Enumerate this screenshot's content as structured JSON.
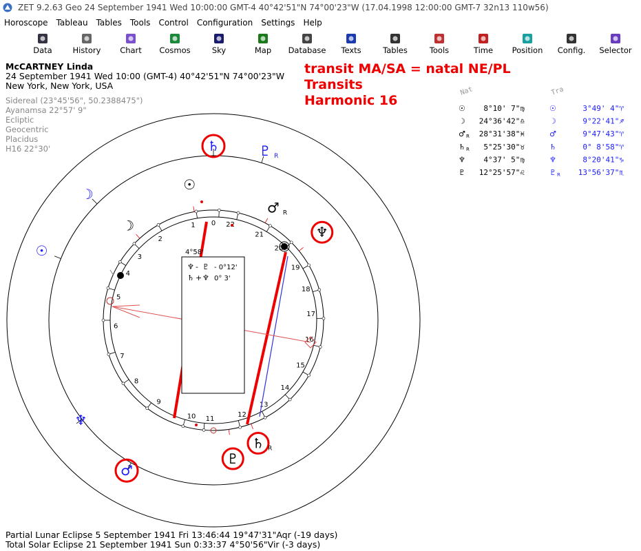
{
  "window": {
    "title": "ZET 9.2.63 Geo   24 September 1941  Wed  10:00:00 GMT-4 40°42'51\"N  74°00'23\"W  (17.04.1998  12:00:00 GMT-7 32n13 110w56)"
  },
  "menu": [
    "Horoscope",
    "Tableau",
    "Tables",
    "Tools",
    "Control",
    "Configuration",
    "Settings",
    "Help"
  ],
  "toolbar": [
    {
      "label": "Data",
      "icon": "data-icon"
    },
    {
      "label": "History",
      "icon": "history-icon"
    },
    {
      "label": "Chart",
      "icon": "chart-icon"
    },
    {
      "label": "Cosmos",
      "icon": "cosmos-icon"
    },
    {
      "label": "Sky",
      "icon": "sky-icon"
    },
    {
      "label": "Map",
      "icon": "map-icon"
    },
    {
      "label": "Database",
      "icon": "database-icon"
    },
    {
      "label": "Texts",
      "icon": "texts-icon"
    },
    {
      "label": "Tables",
      "icon": "tables-icon"
    },
    {
      "label": "Tools",
      "icon": "tools-icon"
    },
    {
      "label": "Time",
      "icon": "time-icon"
    },
    {
      "label": "Position",
      "icon": "position-icon"
    },
    {
      "label": "Config.",
      "icon": "config-icon"
    },
    {
      "label": "Selector",
      "icon": "selector-icon"
    }
  ],
  "header": {
    "name": "McCARTNEY Linda",
    "date_line": "24 September 1941  Wed  10:00 (GMT-4) 40°42'51\"N  74°00'23\"W",
    "place": "New York, New York, USA"
  },
  "subinfo": [
    "Sidereal (23°45'56\", 50.2388475\")",
    "Ayanamsa 22°57' 9\"",
    "Ecliptic",
    "Geocentric",
    "Placidus",
    "H16  22°30'"
  ],
  "annotation": [
    "transit MA/SA = natal NE/PL",
    "Transits",
    "Harmonic 16"
  ],
  "table": {
    "col1_header": "Nat",
    "col2_header": "Tra",
    "rows": [
      {
        "p1": "☉",
        "r1": "",
        "v1": "8°10' 7\"♍",
        "p2": "☉",
        "r2": "",
        "v2": "3°49' 4\"♈"
      },
      {
        "p1": "☽",
        "r1": "",
        "v1": "24°36'42\"♎",
        "p2": "☽",
        "r2": "",
        "v2": "9°22'41\"♐"
      },
      {
        "p1": "♂",
        "r1": "R",
        "v1": "28°31'38\"♓",
        "p2": "♂",
        "r2": "",
        "v2": "9°47'43\"♈"
      },
      {
        "p1": "♄",
        "r1": "R",
        "v1": "5°25'30\"♉",
        "p2": "♄",
        "r2": "",
        "v2": "0° 8'58\"♈"
      },
      {
        "p1": "♆",
        "r1": "",
        "v1": "4°37' 5\"♍",
        "p2": "♆",
        "r2": "",
        "v2": "8°20'41\"♑"
      },
      {
        "p1": "♇",
        "r1": "",
        "v1": "12°25'57\"♌",
        "p2": "♇",
        "r2": "R",
        "v2": "13°56'37\"♏"
      }
    ]
  },
  "chart": {
    "house_numbers": [
      "0",
      "1",
      "2",
      "3",
      "4",
      "5",
      "6",
      "7",
      "8",
      "9",
      "10",
      "11",
      "12",
      "13",
      "14",
      "15",
      "16",
      "17",
      "18",
      "19",
      "20",
      "21",
      "22"
    ],
    "inner_planets": [
      {
        "glyph": "☽",
        "r": "",
        "color": "#000",
        "circled": false
      },
      {
        "glyph": "☉",
        "r": "",
        "color": "#000",
        "circled": false
      },
      {
        "glyph": "♂",
        "r": "R",
        "color": "#000",
        "circled": false
      },
      {
        "glyph": "♆",
        "r": "",
        "color": "#000",
        "circled": true
      },
      {
        "glyph": "♇",
        "r": "",
        "color": "#000",
        "circled": true
      },
      {
        "glyph": "♄",
        "r": "R",
        "color": "#000",
        "circled": true
      }
    ],
    "outer_planets": [
      {
        "glyph": "♄",
        "r": "",
        "color": "#1a1aff",
        "circled": true
      },
      {
        "glyph": "♇",
        "r": "R",
        "color": "#1a1aff",
        "circled": false
      },
      {
        "glyph": "☽",
        "r": "",
        "color": "#1a1aff",
        "circled": false
      },
      {
        "glyph": "☉",
        "r": "",
        "color": "#1a1aff",
        "circled": false
      },
      {
        "glyph": "♆",
        "r": "",
        "color": "#1a1aff",
        "circled": false
      },
      {
        "glyph": "♂",
        "r": "",
        "color": "#1a1aff",
        "circled": true
      }
    ],
    "midpoint_label": "4°58'",
    "aspect_box": [
      {
        "a": "♆",
        "sep": "-",
        "b": "♇",
        "val": "- 0°12'"
      },
      {
        "a": "♄",
        "sep": "+",
        "b": "♆",
        "val": "0° 3'"
      }
    ]
  },
  "footer": [
    "Partial Lunar Eclipse 5 September 1941 Fri 13:46:44 19°47'31\"Aqr (-19 days)",
    "Total Solar Eclipse 21 September 1941 Sun  0:33:37  4°50'56\"Vir (-3 days)"
  ],
  "colors": {
    "accent_red": "#e00000",
    "transit_blue": "#1a1aff"
  }
}
